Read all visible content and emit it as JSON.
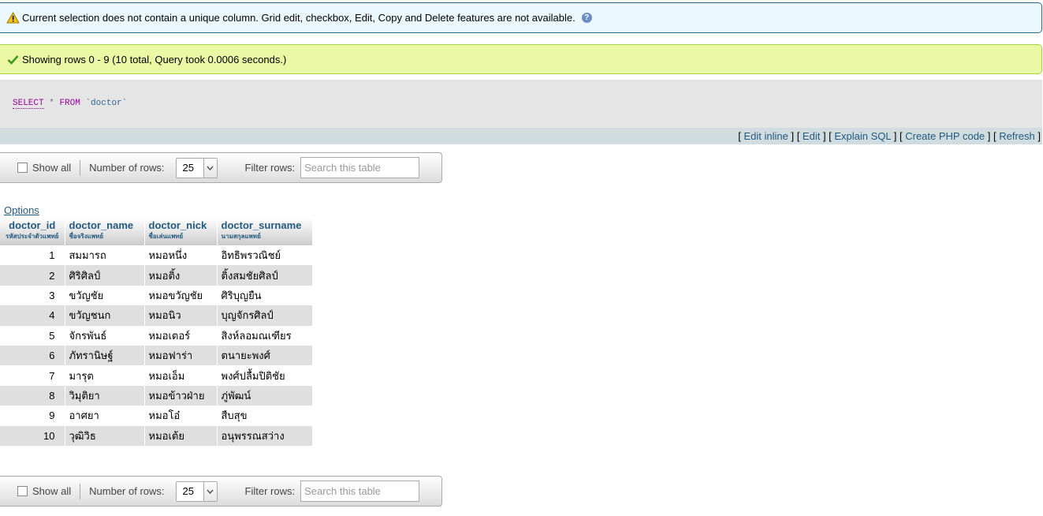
{
  "notice": {
    "text": "Current selection does not contain a unique column. Grid edit, checkbox, Edit, Copy and Delete features are not available.",
    "help_glyph": "?"
  },
  "success": {
    "text": "Showing rows 0 - 9 (10 total, Query took 0.0006 seconds.)"
  },
  "sql": {
    "select": "SELECT",
    "star": "*",
    "from": "FROM",
    "table": "`doctor`"
  },
  "tools": {
    "edit_inline": "Edit inline",
    "edit": "Edit",
    "explain": "Explain SQL",
    "create_php": "Create PHP code",
    "refresh": "Refresh"
  },
  "navbar": {
    "show_all": "Show all",
    "rows_label": "Number of rows:",
    "rows_value": "25",
    "filter_label": "Filter rows:",
    "filter_placeholder": "Search this table"
  },
  "options_label": "Options",
  "table": {
    "columns": [
      {
        "name": "doctor_id",
        "comment": "รหัสประจำตัวแพทย์"
      },
      {
        "name": "doctor_name",
        "comment": "ชื่อจริงแพทย์"
      },
      {
        "name": "doctor_nick",
        "comment": "ชื่อเล่นแพทย์"
      },
      {
        "name": "doctor_surname",
        "comment": "นามสกุลแพทย์"
      }
    ],
    "rows": [
      [
        "1",
        "สมมารถ",
        "หมอหนึ่ง",
        "อิทธิพรวณิชย์"
      ],
      [
        "2",
        "ศิริศิลป์",
        "หมอติ้ง",
        "ติ้งสมชัยศิลป์"
      ],
      [
        "3",
        "ขวัญชัย",
        "หมอขวัญชัย",
        "ศิริบุญยืน"
      ],
      [
        "4",
        "ขวัญชนก",
        "หมอนิว",
        "บุญจักรศิลป์"
      ],
      [
        "5",
        "จักรพันธ์",
        "หมอเตอร์",
        "สิงห์ลอมณเฑียร"
      ],
      [
        "6",
        "ภัทรานิษฐ์",
        "หมอฟาร่า",
        "ตนายะพงศ์"
      ],
      [
        "7",
        "มารุต",
        "หมอเอ็ม",
        "พงศ์ปลื้มปิติชัย"
      ],
      [
        "8",
        "วิมุติยา",
        "หมอข้าวฝ่าย",
        "ภู่พัฒน์"
      ],
      [
        "9",
        "อาศยา",
        "หมอโอ๋",
        "สืบสุข"
      ],
      [
        "10",
        "วุฒิวิธ",
        "หมอเต้ย",
        "อนุพรรณสว่าง"
      ]
    ]
  }
}
